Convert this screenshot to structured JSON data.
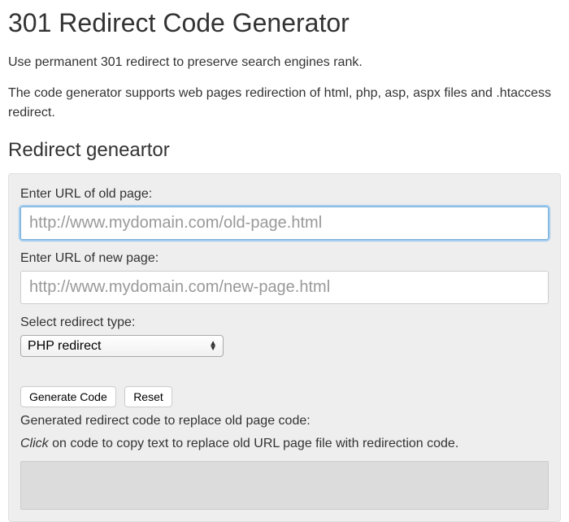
{
  "page": {
    "title": "301 Redirect Code Generator",
    "intro1": "Use permanent 301 redirect to preserve search engines rank.",
    "intro2": "The code generator supports web pages redirection of html, php, asp, aspx files and .htaccess redirect.",
    "section_heading": "Redirect geneartor"
  },
  "form": {
    "old_url": {
      "label": "Enter URL of old page:",
      "placeholder": "http://www.mydomain.com/old-page.html",
      "value": ""
    },
    "new_url": {
      "label": "Enter URL of new page:",
      "placeholder": "http://www.mydomain.com/new-page.html",
      "value": ""
    },
    "redirect_type": {
      "label": "Select redirect type:",
      "selected": "PHP redirect"
    },
    "buttons": {
      "generate": "Generate Code",
      "reset": "Reset"
    },
    "output": {
      "label": "Generated redirect code to replace old page code:",
      "hint_em": "Click",
      "hint_rest": " on code to copy text to replace old URL page file with redirection code."
    }
  }
}
